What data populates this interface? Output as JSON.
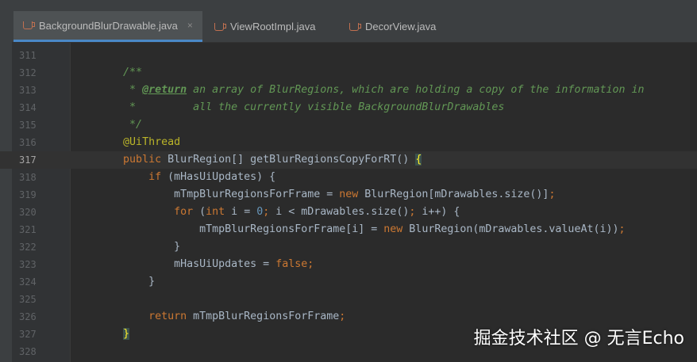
{
  "tabs": [
    {
      "label": "BackgroundBlurDrawable.java",
      "active": true,
      "close": "×"
    },
    {
      "label": "ViewRootImpl.java"
    },
    {
      "label": "DecorView.java"
    }
  ],
  "current_line": 317,
  "lines": [
    {
      "n": "311",
      "t": []
    },
    {
      "n": "312",
      "t": [
        [
          "        ",
          ""
        ],
        [
          "/**",
          "cm"
        ]
      ]
    },
    {
      "n": "313",
      "t": [
        [
          "         * ",
          "cm"
        ],
        [
          "@return",
          "tag"
        ],
        [
          " an array of BlurRegions, which are holding a copy of the information in",
          "cm"
        ]
      ]
    },
    {
      "n": "314",
      "t": [
        [
          "         *         all the currently visible BackgroundBlurDrawables",
          "cm"
        ]
      ]
    },
    {
      "n": "315",
      "t": [
        [
          "         */",
          "cm"
        ]
      ]
    },
    {
      "n": "316",
      "t": [
        [
          "        ",
          ""
        ],
        [
          "@UiThread",
          "an"
        ]
      ]
    },
    {
      "n": "317",
      "t": [
        [
          "        ",
          ""
        ],
        [
          "public",
          "kw"
        ],
        [
          " BlurRegion[] getBlurRegionsCopyForRT() ",
          ""
        ],
        [
          "{",
          "br"
        ]
      ]
    },
    {
      "n": "318",
      "t": [
        [
          "            ",
          ""
        ],
        [
          "if",
          "kw"
        ],
        [
          " (mHasUiUpdates) {",
          ""
        ]
      ]
    },
    {
      "n": "319",
      "t": [
        [
          "                mTmpBlurRegionsForFrame = ",
          ""
        ],
        [
          "new",
          "kw"
        ],
        [
          " BlurRegion[mDrawables.size()]",
          ""
        ],
        [
          ";",
          "kw"
        ]
      ]
    },
    {
      "n": "320",
      "t": [
        [
          "                ",
          ""
        ],
        [
          "for",
          "kw"
        ],
        [
          " (",
          ""
        ],
        [
          "int",
          "kw"
        ],
        [
          " i = ",
          ""
        ],
        [
          "0",
          "num"
        ],
        [
          "; ",
          "kw"
        ],
        [
          "i < mDrawables.size()",
          ""
        ],
        [
          "; ",
          "kw"
        ],
        [
          "i++) {",
          ""
        ]
      ]
    },
    {
      "n": "321",
      "t": [
        [
          "                    mTmpBlurRegionsForFrame[i] = ",
          ""
        ],
        [
          "new",
          "kw"
        ],
        [
          " BlurRegion(mDrawables.valueAt(i))",
          ""
        ],
        [
          ";",
          "kw"
        ]
      ]
    },
    {
      "n": "322",
      "t": [
        [
          "                }",
          ""
        ]
      ]
    },
    {
      "n": "323",
      "t": [
        [
          "                mHasUiUpdates = ",
          ""
        ],
        [
          "false",
          "kw"
        ],
        [
          ";",
          "kw"
        ]
      ]
    },
    {
      "n": "324",
      "t": [
        [
          "            }",
          ""
        ]
      ]
    },
    {
      "n": "325",
      "t": []
    },
    {
      "n": "326",
      "t": [
        [
          "            ",
          ""
        ],
        [
          "return",
          "kw"
        ],
        [
          " mTmpBlurRegionsForFrame",
          ""
        ],
        [
          ";",
          "kw"
        ]
      ]
    },
    {
      "n": "327",
      "t": [
        [
          "        ",
          ""
        ],
        [
          "}",
          "br"
        ]
      ]
    },
    {
      "n": "328",
      "t": []
    }
  ],
  "watermark": "掘金技术社区 @ 无言Echo"
}
